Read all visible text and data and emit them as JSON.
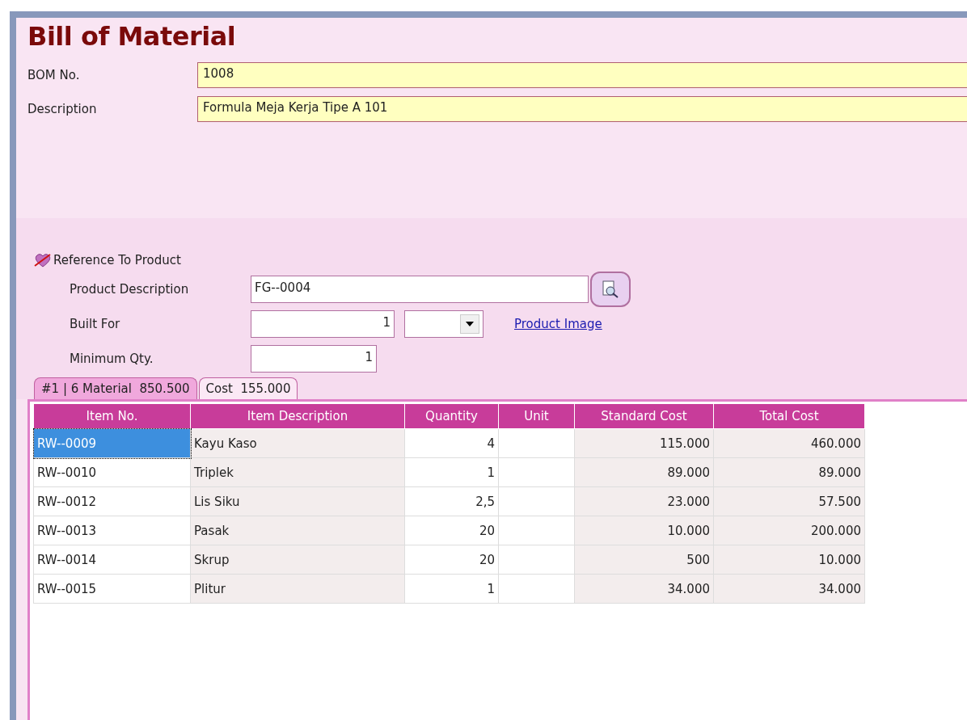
{
  "title": "Bill of Material",
  "header_fields": [
    {
      "label": "BOM No.",
      "value": "1008"
    },
    {
      "label": "Description",
      "value": "Formula Meja Kerja Tipe A 101"
    }
  ],
  "reference": {
    "title": "Reference To Product",
    "product_description": {
      "label": "Product Description",
      "value": "FG--0004"
    },
    "built_for": {
      "label": "Built For",
      "value": "1"
    },
    "product_image_link": "Product Image",
    "minimum_qty": {
      "label": "Minimum Qty.",
      "value": "1"
    }
  },
  "tabs": [
    {
      "label": "#1 | 6 Material  850.500",
      "selected": true
    },
    {
      "label": "Cost  155.000",
      "selected": false
    }
  ],
  "table": {
    "columns": [
      "Item No.",
      "Item Description",
      "Quantity",
      "Unit",
      "Standard Cost",
      "Total Cost"
    ],
    "rows": [
      {
        "selected": true,
        "cells": [
          "RW--0009",
          "Kayu Kaso",
          "4",
          "",
          "115.000",
          "460.000"
        ]
      },
      {
        "selected": false,
        "cells": [
          "RW--0010",
          "Triplek",
          "1",
          "",
          "89.000",
          "89.000"
        ]
      },
      {
        "selected": false,
        "cells": [
          "RW--0012",
          "Lis Siku",
          "2,5",
          "",
          "23.000",
          "57.500"
        ]
      },
      {
        "selected": false,
        "cells": [
          "RW--0013",
          "Pasak",
          "20",
          "",
          "10.000",
          "200.000"
        ]
      },
      {
        "selected": false,
        "cells": [
          "RW--0014",
          "Skrup",
          "20",
          "",
          "500",
          "10.000"
        ]
      },
      {
        "selected": false,
        "cells": [
          "RW--0015",
          "Plitur",
          "1",
          "",
          "34.000",
          "34.000"
        ]
      }
    ]
  }
}
